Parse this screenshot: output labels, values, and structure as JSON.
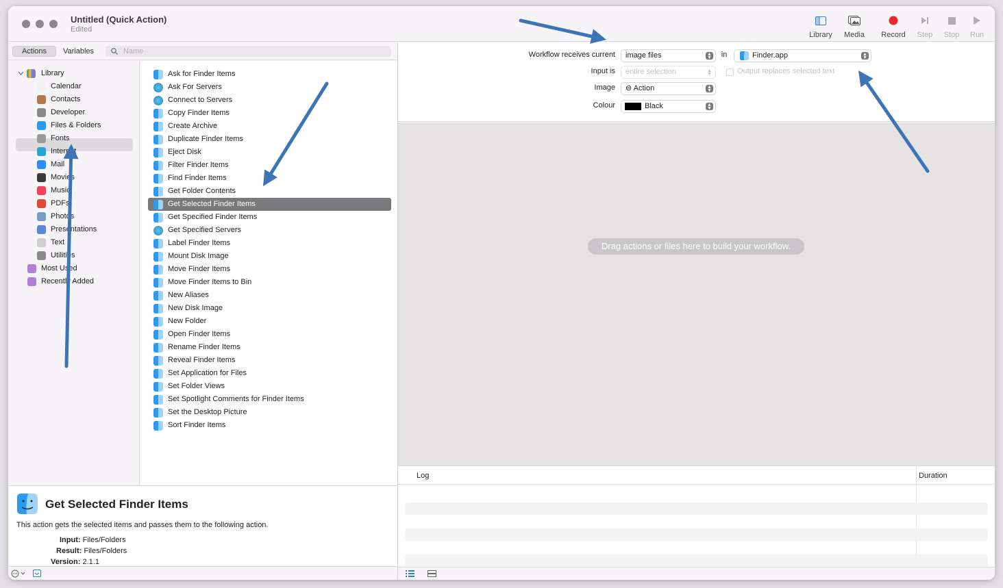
{
  "window": {
    "title": "Untitled (Quick Action)",
    "subtitle": "Edited"
  },
  "toolbar": {
    "library": "Library",
    "media": "Media",
    "record": "Record",
    "step": "Step",
    "stop": "Stop",
    "run": "Run"
  },
  "left_tabs": {
    "actions": "Actions",
    "variables": "Variables",
    "search_placeholder": "Name"
  },
  "library": {
    "root": "Library",
    "items": [
      {
        "label": "Calendar",
        "icon": "calendar-icon",
        "color": "#f1f1f1"
      },
      {
        "label": "Contacts",
        "icon": "contacts-icon",
        "color": "#b07a4a"
      },
      {
        "label": "Developer",
        "icon": "tools-icon",
        "color": "#8a8a8a"
      },
      {
        "label": "Files & Folders",
        "icon": "finder-icon",
        "color": "#2b9af3"
      },
      {
        "label": "Fonts",
        "icon": "fonts-icon",
        "color": "#9a9a9a"
      },
      {
        "label": "Internet",
        "icon": "globe-icon",
        "color": "#2aa6c9"
      },
      {
        "label": "Mail",
        "icon": "mail-icon",
        "color": "#2f8ef0"
      },
      {
        "label": "Movies",
        "icon": "movies-icon",
        "color": "#3a3a3a"
      },
      {
        "label": "Music",
        "icon": "music-icon",
        "color": "#f04457"
      },
      {
        "label": "PDFs",
        "icon": "pdf-icon",
        "color": "#e04a3a"
      },
      {
        "label": "Photos",
        "icon": "photos-icon",
        "color": "#7a9cc0"
      },
      {
        "label": "Presentations",
        "icon": "presentation-icon",
        "color": "#5a8ad6"
      },
      {
        "label": "Text",
        "icon": "text-icon",
        "color": "#cfcfcf"
      },
      {
        "label": "Utilities",
        "icon": "utilities-icon",
        "color": "#8a8a8a"
      }
    ],
    "smart": [
      {
        "label": "Most Used",
        "icon": "smart-folder-icon",
        "color": "#b07fd6"
      },
      {
        "label": "Recently Added",
        "icon": "smart-folder-icon",
        "color": "#b07fd6"
      }
    ]
  },
  "actions_list": [
    "Ask for Finder Items",
    "Ask For Servers",
    "Connect to Servers",
    "Copy Finder Items",
    "Create Archive",
    "Duplicate Finder Items",
    "Eject Disk",
    "Filter Finder Items",
    "Find Finder Items",
    "Get Folder Contents",
    "Get Selected Finder Items",
    "Get Specified Finder Items",
    "Get Specified Servers",
    "Label Finder Items",
    "Mount Disk Image",
    "Move Finder Items",
    "Move Finder Items to Bin",
    "New Aliases",
    "New Disk Image",
    "New Folder",
    "Open Finder Items",
    "Rename Finder Items",
    "Reveal Finder Items",
    "Set Application for Files",
    "Set Folder Views",
    "Set Spotlight Comments for Finder Items",
    "Set the Desktop Picture",
    "Sort Finder Items"
  ],
  "selected_action": "Get Selected Finder Items",
  "description": {
    "title": "Get Selected Finder Items",
    "text": "This action gets the selected items and passes them to the following action.",
    "input_label": "Input:",
    "input_value": "Files/Folders",
    "result_label": "Result:",
    "result_value": "Files/Folders",
    "version_label": "Version:",
    "version_value": "2.1.1"
  },
  "workflow": {
    "receives_label": "Workflow receives current",
    "receives_value": "image files",
    "in_label": "in",
    "app_value": "Finder.app",
    "input_is_label": "Input is",
    "input_is_value": "entire selection",
    "output_replaces": "Output replaces selected text",
    "image_label": "Image",
    "image_value": "⊖ Action",
    "colour_label": "Colour",
    "colour_value": "Black",
    "colour_swatch": "#000000"
  },
  "canvas_hint": "Drag actions or files here to build your workflow.",
  "log": {
    "log_col": "Log",
    "duration_col": "Duration"
  },
  "colors": {
    "record": "#e8262d",
    "annotation_arrow": "#3d74b6"
  }
}
